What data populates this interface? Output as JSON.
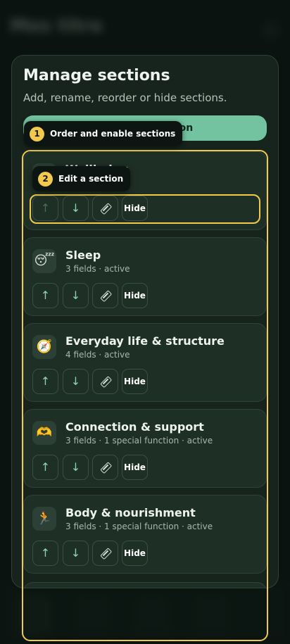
{
  "background": {
    "title": "Mes titre"
  },
  "panel": {
    "title": "Manage sections",
    "subtitle": "Add, rename, reorder or hide sections.",
    "add_button_label": "ion"
  },
  "sections": [
    {
      "name": "Wellbeing",
      "meta": "",
      "icon": "wellbeing-icon",
      "emoji": "🙂",
      "up_disabled": true
    },
    {
      "name": "Sleep",
      "meta": "3 fields · active",
      "icon": "sleep-icon",
      "emoji": "😴",
      "up_disabled": false
    },
    {
      "name": "Everyday life & structure",
      "meta": "4 fields · active",
      "icon": "compass-icon",
      "emoji": "🧭",
      "up_disabled": false
    },
    {
      "name": "Connection & support",
      "meta": "3 fields · 1 special function · active",
      "icon": "heart-hands-icon",
      "emoji": "🫶",
      "up_disabled": false
    },
    {
      "name": "Body & nourishment",
      "meta": "3 fields · 1 special function · active",
      "icon": "runner-icon",
      "emoji": "🏃",
      "up_disabled": false
    }
  ],
  "controls": {
    "up": "↑",
    "down": "↓",
    "hide": "Hide"
  },
  "tutorial": {
    "step1_number": "1",
    "step1_text": "Order and enable sections",
    "step2_number": "2",
    "step2_text": "Edit a section",
    "highlight_color": "#f2c94c"
  },
  "colors": {
    "accent": "#73c3a0",
    "panel_bg": "#17241d",
    "card_bg": "#1e2f26"
  }
}
